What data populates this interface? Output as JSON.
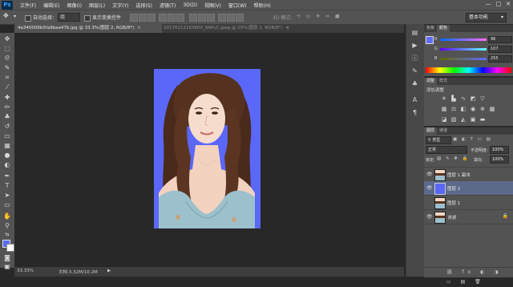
{
  "app": {
    "logo": "Ps"
  },
  "menu": [
    "文件(F)",
    "编辑(E)",
    "图像(I)",
    "图层(L)",
    "文字(Y)",
    "选择(S)",
    "滤镜(T)",
    "3D(D)",
    "视图(V)",
    "窗口(W)",
    "帮助(H)"
  ],
  "window_controls": {
    "minimize": "—",
    "maximize": "□",
    "close": "✕"
  },
  "options": {
    "auto_select_label": "自动选择：",
    "auto_select_value": "组",
    "transform_label": "显示变换控件",
    "mode_3d_label": "3D 模式：",
    "workspace": "基本功能"
  },
  "tabs": [
    {
      "label": "4a340006b5fa9baa47b.jpg @ 33.3%(图层 2, RGB/8*)",
      "close": "×"
    },
    {
      "label": "20170212163600_8APuC.jpeg @ 25%(图层 2, RGB/8*)",
      "close": "×"
    }
  ],
  "status": {
    "zoom": "33.33%",
    "doc": "文档:3.32M/10.2M",
    "arrow": "▶"
  },
  "color_panel": {
    "tabs": [
      "色板",
      "颜色"
    ],
    "channels": [
      {
        "label": "R",
        "value": "96"
      },
      {
        "label": "G",
        "value": "107"
      },
      {
        "label": "B",
        "value": "255"
      }
    ],
    "fg_color": "#606bff"
  },
  "adjust_panel": {
    "tabs": [
      "调整",
      "样式"
    ],
    "title": "添加调整"
  },
  "layers_panel": {
    "tabs": [
      "图层",
      "通道"
    ],
    "filter_kind": "类型",
    "blend_mode": "正常",
    "opacity_label": "不透明度:",
    "opacity_value": "100%",
    "lock_label": "锁定:",
    "fill_label": "填充:",
    "fill_value": "100%",
    "layers": [
      {
        "name": "图层 1 副本",
        "visible": true
      },
      {
        "name": "图层 2",
        "visible": true,
        "selected": true
      },
      {
        "name": "图层 1",
        "visible": false
      },
      {
        "name": "背景",
        "visible": true
      }
    ]
  },
  "colors": {
    "canvas_bg": "#5b67f8",
    "fg": "#5a6bff",
    "bg": "#ffffff",
    "selection": "#5c6a8a"
  }
}
